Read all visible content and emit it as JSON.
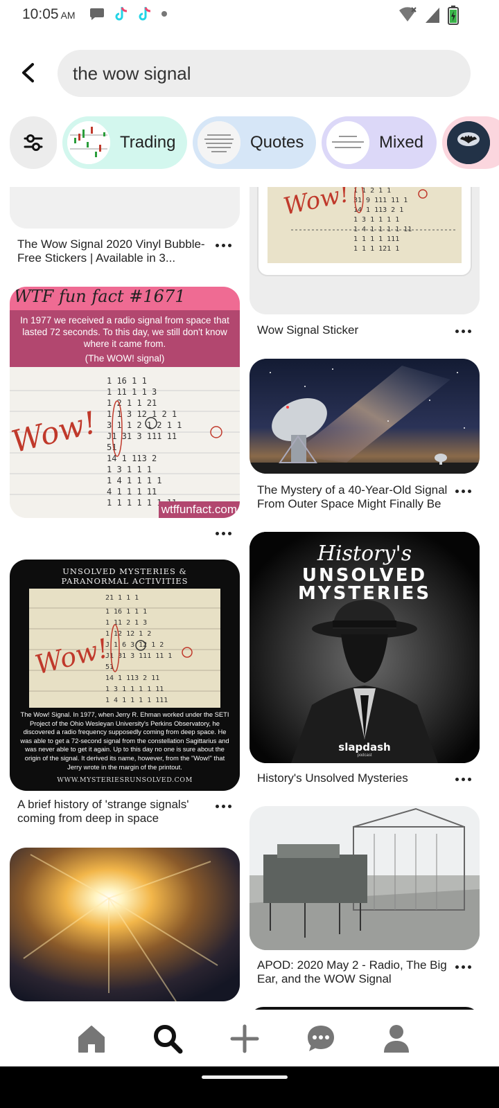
{
  "status_bar": {
    "time": "10:05",
    "ampm": "AM",
    "left_icons": [
      "chat-bubble-icon",
      "tiktok-icon",
      "tiktok-icon",
      "dot-icon"
    ],
    "right_icons": [
      "wifi-off-icon",
      "signal-icon",
      "battery-charging-icon"
    ]
  },
  "search": {
    "query": "the wow signal"
  },
  "chips": [
    {
      "label": "Trading",
      "bg": "#d3f7ee"
    },
    {
      "label": "Quotes",
      "bg": "#d6e6f7"
    },
    {
      "label": "Mixed",
      "bg": "#dcd8f8"
    },
    {
      "label": "",
      "bg": "#fbd6de"
    }
  ],
  "pins": {
    "sticker_left": {
      "title": "The Wow Signal 2020 Vinyl Bubble-Free Stickers | Available in 3..."
    },
    "wow_sticker_right": {
      "title": "Wow Signal Sticker",
      "image_text": "Wow!"
    },
    "wtf_fact": {
      "header": "WTF fun fact #1671",
      "body": "In 1977 we received a radio signal from space that lasted 72 seconds. To this day, we still don't know where it came from.",
      "caption": "(The WOW! signal)",
      "handwriting": "Wow!",
      "watermark": "wtffunfact.com"
    },
    "mystery_40": {
      "title": "The Mystery of a 40-Year-Old Signal From Outer Space Might Finally Be ..."
    },
    "unsolved_left": {
      "header_line1": "UNSOLVED MYSTERIES &",
      "header_line2": "PARANORMAL ACTIVITIES",
      "handwriting": "Wow!",
      "body": "The Wow! Signal. In 1977, when Jerry R. Ehman worked under the SETI Project of the Ohio Wesleyan University's Perkins Observatory, he discovered a radio frequency supposedly coming from deep space. He was able to get a 72-second signal from the constellation Sagittarius and was never able to get it again. Up to this day no one is sure about the origin of the signal. It derived its name, however, from the \"Wow!\" that Jerry wrote in the margin of the printout.",
      "footer": "WWW.MYSTERIESRUNSOLVED.COM",
      "title": "A brief history of 'strange signals' coming from deep in space"
    },
    "history_unsolved": {
      "script_title": "History's",
      "line1": "UNSOLVED",
      "line2": "MYSTERIES",
      "brand": "slapdash",
      "brand_sub": "podcast",
      "title": "History's Unsolved Mysteries"
    },
    "apod": {
      "title": "APOD: 2020 May 2 - Radio, The Big Ear, and the WOW Signal"
    }
  },
  "nav": {
    "items": [
      "home-icon",
      "search-icon",
      "plus-icon",
      "messages-icon",
      "profile-icon"
    ]
  },
  "colors": {
    "wtf_pink": "#ef6b93",
    "wtf_band": "#b2476f",
    "red_ink": "#c0392b",
    "paper": "#ebe5cf"
  }
}
